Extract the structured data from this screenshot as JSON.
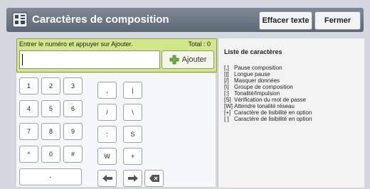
{
  "titlebar": {
    "title": "Caractères de composition",
    "clear_label": "Effacer texte",
    "close_label": "Fermer"
  },
  "entry": {
    "instruction": "Entrer le numéro et appuyer sur Ajouter.",
    "total": "Total : 0",
    "value": "",
    "add_label": "Ajouter"
  },
  "keypad": {
    "digits": [
      "1",
      "2",
      "3",
      "4",
      "5",
      "6",
      "7",
      "8",
      "9",
      "*",
      "0",
      "#"
    ],
    "special": [
      ",",
      "|",
      "/",
      "\\",
      ":",
      "S",
      "W",
      "+"
    ],
    "dash": "-",
    "icons": [
      "arrow-left-icon",
      "arrow-right-icon",
      "backspace-icon"
    ]
  },
  "char_list": {
    "title": "Liste de caractères",
    "items": [
      {
        "code": "[,]",
        "desc": "Pause composition"
      },
      {
        "code": "[|]",
        "desc": "Longue pause"
      },
      {
        "code": "[/]",
        "desc": "Masquer données"
      },
      {
        "code": "[\\]",
        "desc": "Groupe de composition"
      },
      {
        "code": "[:]",
        "desc": "Tonalité/Impulsion"
      },
      {
        "code": "[S]",
        "desc": "Vérification du mot de passe"
      },
      {
        "code": "[W]",
        "desc": "Attendre tonalité réseau"
      },
      {
        "code": "[+]",
        "desc": "Caractère de lisibilité en option"
      },
      {
        "code": "[ ]",
        "desc": "Caractère de lisibilité en option"
      }
    ]
  }
}
